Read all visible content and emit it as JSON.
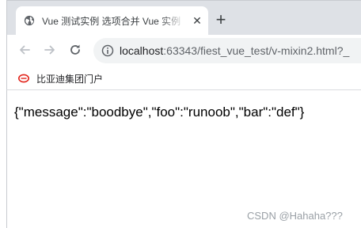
{
  "tab": {
    "title": "Vue 测试实例 选项合并 Vue 实例",
    "favicon": "globe-icon",
    "close_icon": "close-icon"
  },
  "toolbar": {
    "back_icon": "arrow-left-icon",
    "forward_icon": "arrow-right-icon",
    "reload_icon": "reload-icon",
    "info_icon": "info-icon",
    "url_host": "localhost",
    "url_rest": ":63343/fiest_vue_test/v-mixin2.html?_"
  },
  "bookmarks": {
    "items": [
      {
        "label": "比亚迪集团门户",
        "icon": "byd-logo-icon"
      }
    ]
  },
  "page": {
    "output": "{\"message\":\"boodbye\",\"foo\":\"runoob\",\"bar\":\"def\"}"
  },
  "watermark": "CSDN @Hahaha???",
  "colors": {
    "tabstrip": "#dee1e6",
    "omnibox": "#f1f3f4",
    "icon": "#5f6368",
    "byd_red": "#e2231a"
  }
}
